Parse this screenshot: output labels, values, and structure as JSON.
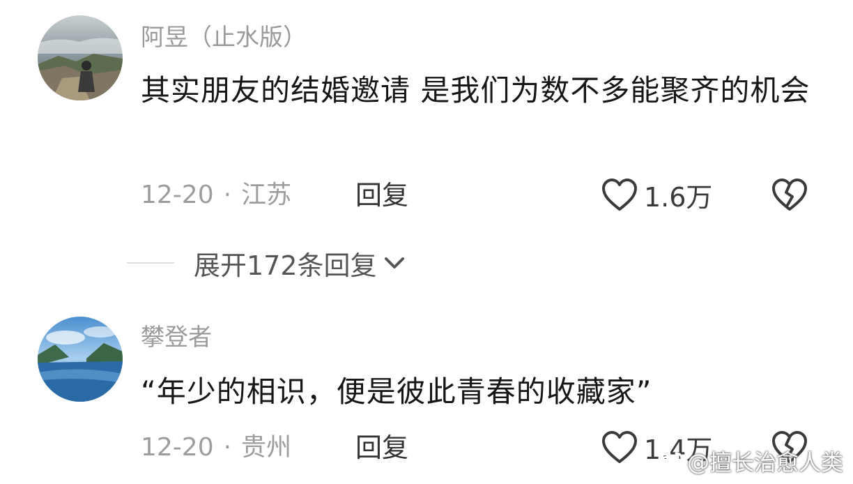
{
  "comments": [
    {
      "username": "阿昱（止水版）",
      "text": "其实朋友的结婚邀请 是我们为数不多能聚齐的机会",
      "date": "12-20",
      "location": "江苏",
      "reply_label": "回复",
      "likes": "1.6万",
      "avatar": "person-on-mountain-cliff-avatar"
    },
    {
      "username": "攀登者",
      "text": "“年少的相识，便是彼此青春的收藏家”",
      "date": "12-20",
      "location": "贵州",
      "reply_label": "回复",
      "likes": "1.4万",
      "avatar": "river-valley-landscape-avatar"
    }
  ],
  "expand_replies": {
    "label": "展开172条回复"
  },
  "watermark": {
    "text": "@擅长治愈人类",
    "icon": "weibo-logo-icon"
  },
  "icons": {
    "like": "heart-outline-icon",
    "dislike": "broken-heart-icon",
    "expand": "chevron-down-icon"
  },
  "colors": {
    "username": "#9a9a9a",
    "meta": "#9d9d9d",
    "body_text": "#161616"
  }
}
